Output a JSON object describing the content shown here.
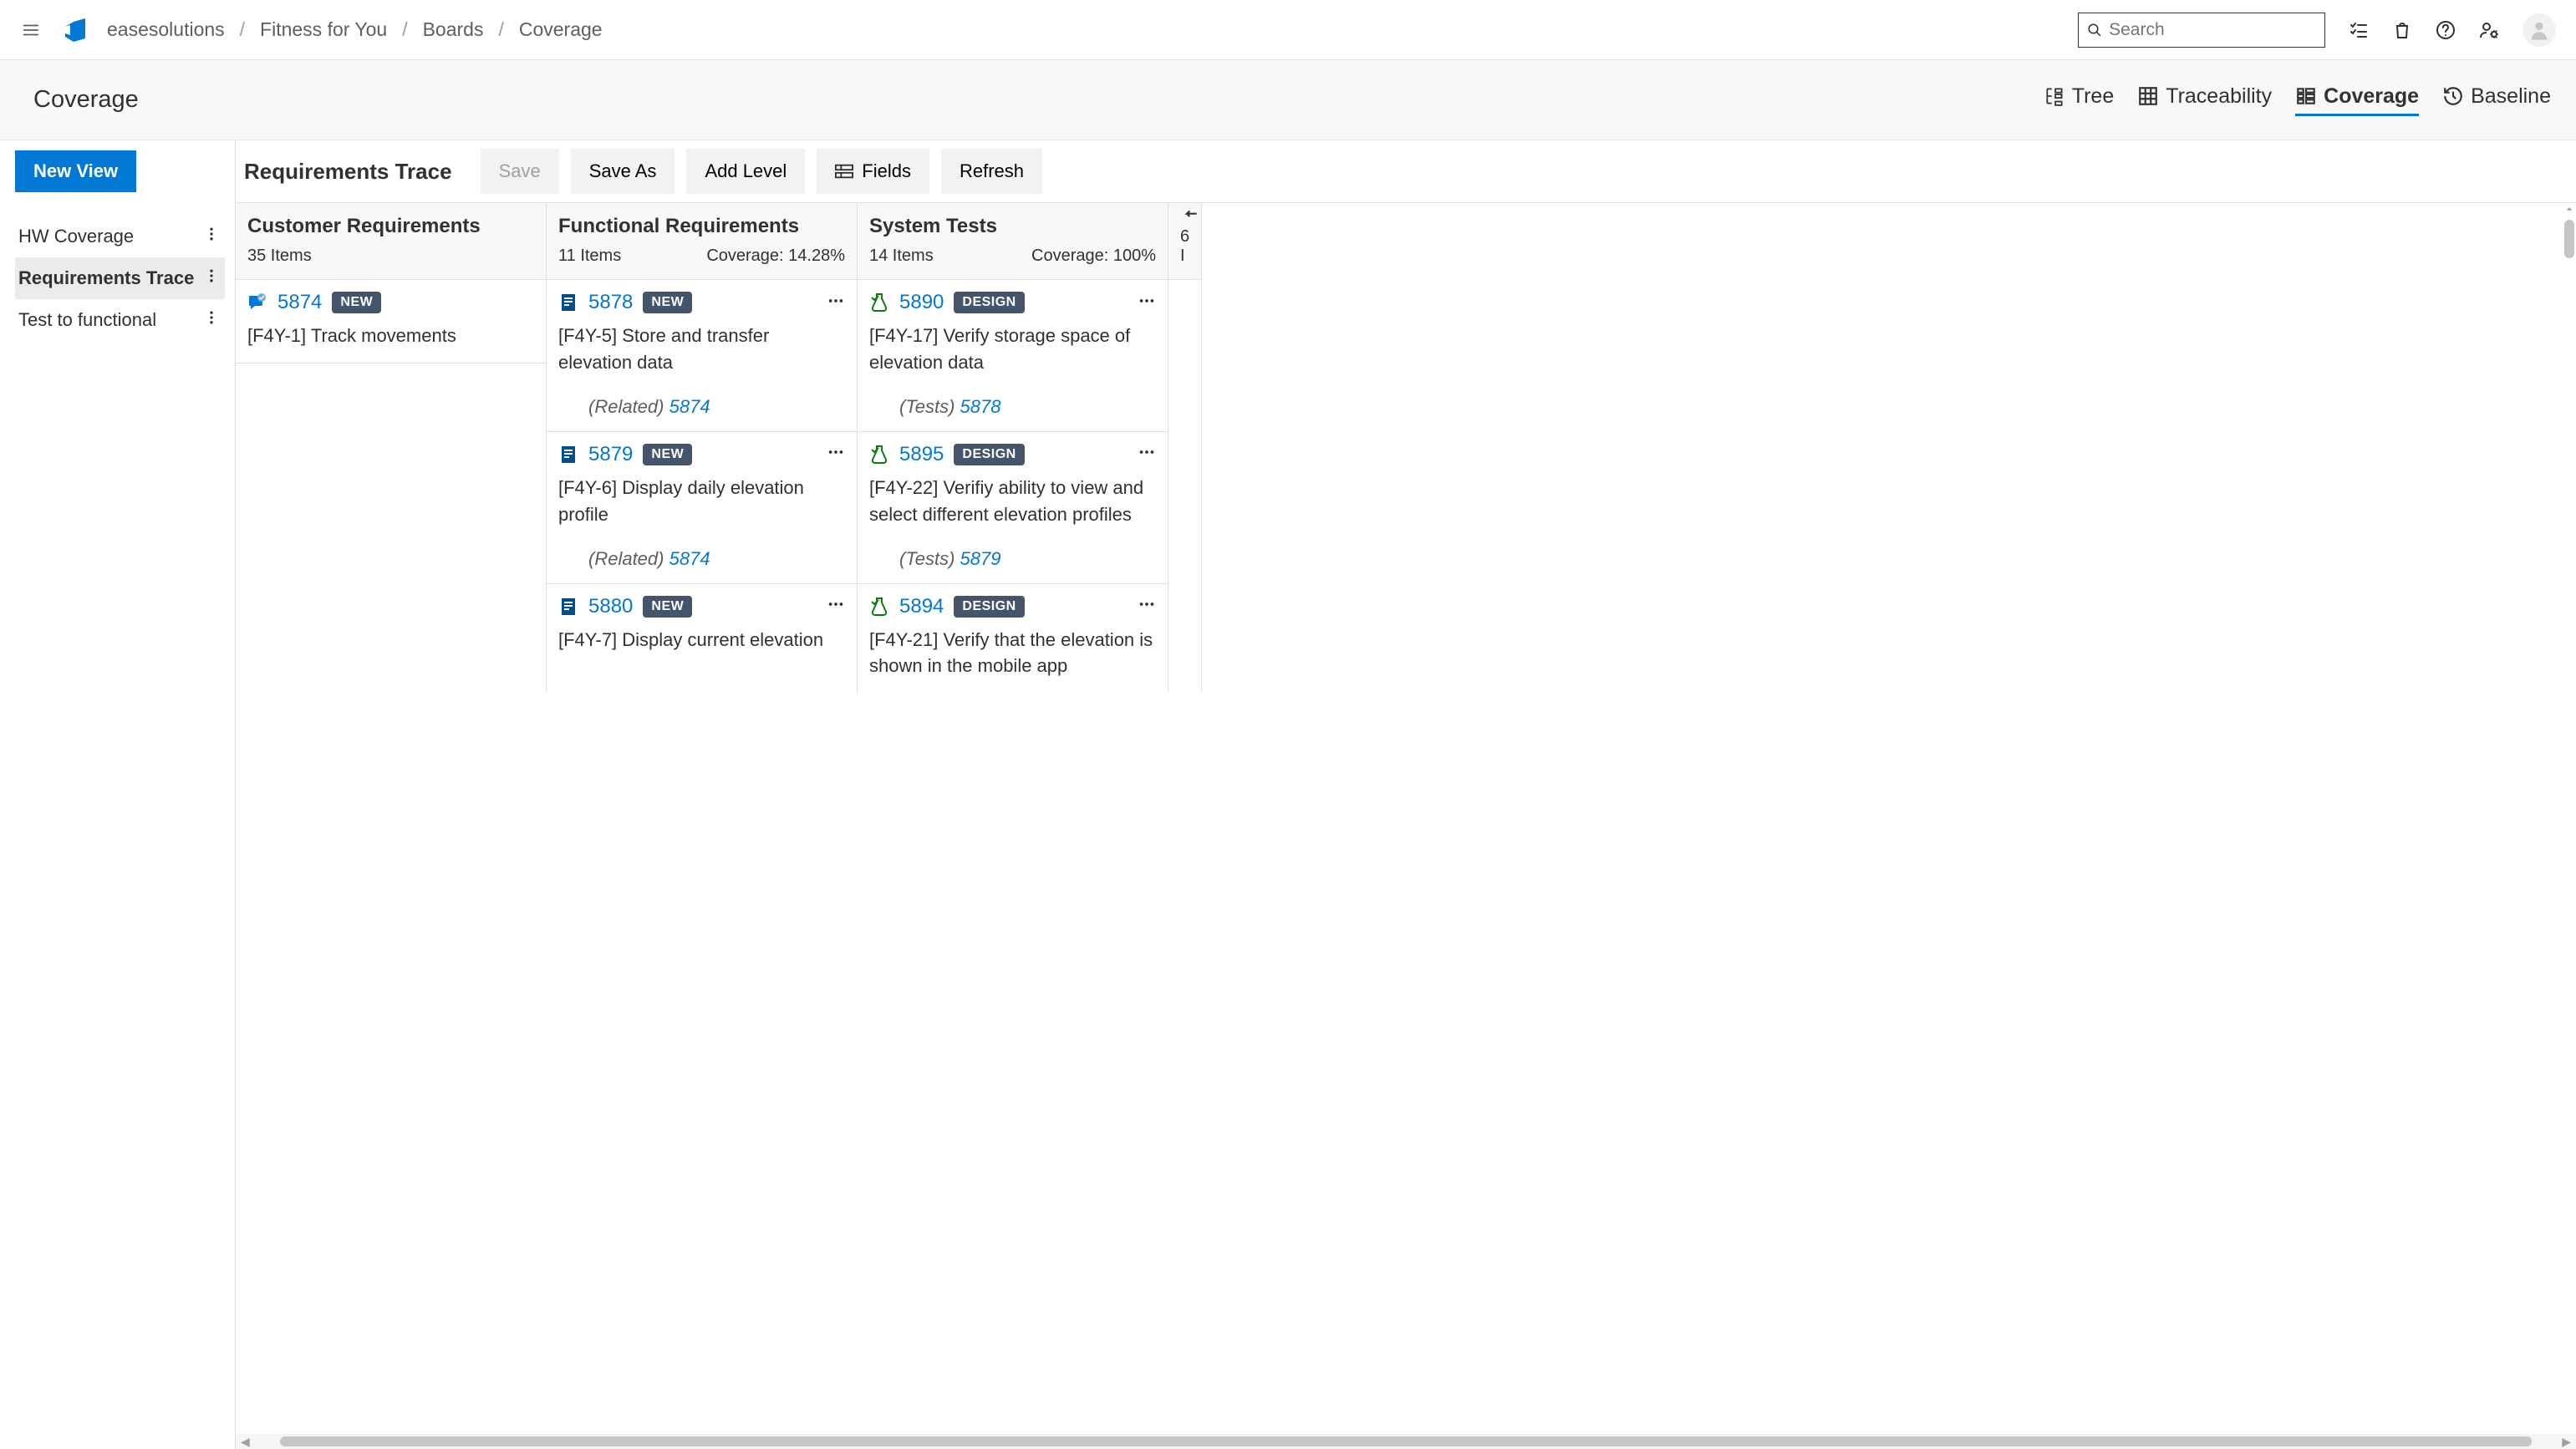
{
  "breadcrumb": [
    "easesolutions",
    "Fitness for You",
    "Boards",
    "Coverage"
  ],
  "search_placeholder": "Search",
  "page_title": "Coverage",
  "view_tabs": {
    "tree": "Tree",
    "trace": "Traceability",
    "coverage": "Coverage",
    "baseline": "Baseline"
  },
  "sidebar": {
    "new_view": "New View",
    "items": [
      {
        "label": "HW Coverage"
      },
      {
        "label": "Requirements Trace"
      },
      {
        "label": "Test to functional"
      }
    ]
  },
  "toolbar": {
    "title": "Requirements Trace",
    "save": "Save",
    "save_as": "Save As",
    "add_level": "Add Level",
    "fields": "Fields",
    "refresh": "Refresh"
  },
  "columns": {
    "c1": {
      "title": "Customer Requirements",
      "count": "35 Items",
      "coverage": "",
      "cards": [
        {
          "id": "5874",
          "badge": "NEW",
          "title": "[F4Y-1] Track movements",
          "icon": "feedback",
          "menu": false
        }
      ]
    },
    "c2": {
      "title": "Functional Requirements",
      "count": "11 Items",
      "coverage": "Coverage: 14.28%",
      "cards": [
        {
          "id": "5878",
          "badge": "NEW",
          "title": "[F4Y-5] Store and transfer elevation data",
          "icon": "req",
          "rel_label": "(Related)",
          "rel_id": "5874",
          "menu": true
        },
        {
          "id": "5879",
          "badge": "NEW",
          "title": "[F4Y-6] Display daily elevation profile",
          "icon": "req",
          "rel_label": "(Related)",
          "rel_id": "5874",
          "menu": true
        },
        {
          "id": "5880",
          "badge": "NEW",
          "title": "[F4Y-7] Display current elevation",
          "icon": "req",
          "menu": true
        }
      ]
    },
    "c3": {
      "title": "System Tests",
      "count": "14 Items",
      "coverage": "Coverage: 100%",
      "cards": [
        {
          "id": "5890",
          "badge": "DESIGN",
          "title": "[F4Y-17] Verify storage space of elevation data",
          "icon": "test",
          "rel_label": "(Tests)",
          "rel_id": "5878",
          "menu": true
        },
        {
          "id": "5895",
          "badge": "DESIGN",
          "title": "[F4Y-22] Verifiy ability to view and select different elevation profiles",
          "icon": "test",
          "rel_label": "(Tests)",
          "rel_id": "5879",
          "menu": true
        },
        {
          "id": "5894",
          "badge": "DESIGN",
          "title": "[F4Y-21] Verify that the elevation is shown in the mobile app",
          "icon": "test",
          "menu": true
        }
      ]
    },
    "c4": {
      "count": "6 I"
    }
  }
}
